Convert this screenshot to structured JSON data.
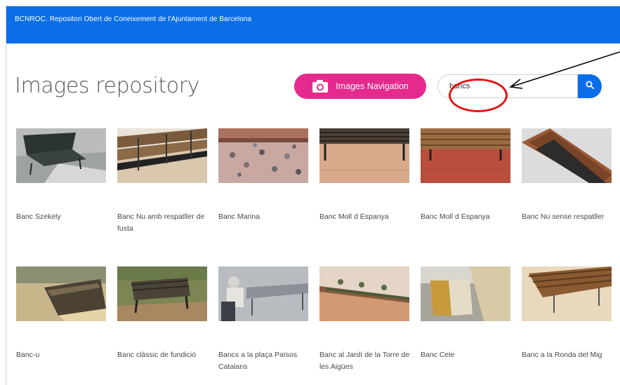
{
  "header": {
    "site_title": "BCNROC. Repositori Obert de Coneixement de l'Ajuntament de Barcelona"
  },
  "page": {
    "title": "Images repository"
  },
  "navigation_button": {
    "label": "Images Navigation",
    "icon": "camera-icon"
  },
  "search": {
    "value": "bancs",
    "button_icon": "search-icon"
  },
  "colors": {
    "header": "#0a6ee8",
    "nav_button": "#e6298d",
    "search_button": "#0a6ee8",
    "annotation": "#e11616"
  },
  "gallery": {
    "rows": [
      [
        {
          "title": "Banc Szekely"
        },
        {
          "title": "Banc Nu amb respatller de fusta"
        },
        {
          "title": "Banc Marina"
        },
        {
          "title": "Banc Moll d Espanya"
        },
        {
          "title": "Banc Moll d Espanya"
        },
        {
          "title": "Banc Nu sense respatller"
        }
      ],
      [
        {
          "title": "Banc-u"
        },
        {
          "title": "Banc clàssic de fundició"
        },
        {
          "title": "Bancs a la plaça Països Catalans"
        },
        {
          "title": "Banc al Jardí de la Torre de les Aigües"
        },
        {
          "title": "Banc Cele"
        },
        {
          "title": "Banc a la Ronda del Mig"
        }
      ]
    ]
  }
}
